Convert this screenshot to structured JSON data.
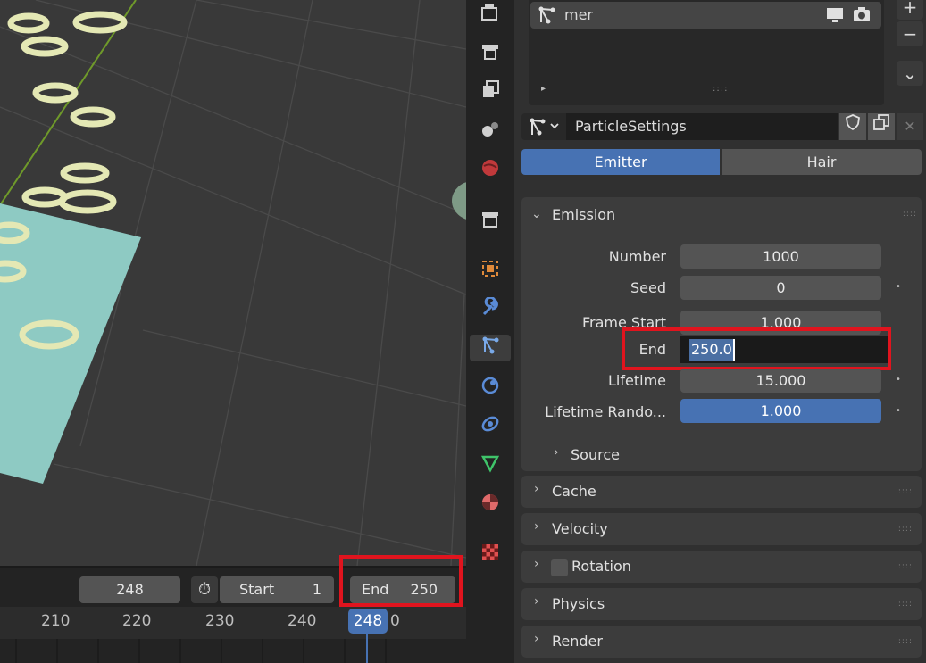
{
  "viewport": {},
  "timeline": {
    "current_frame": "248",
    "start_label": "Start",
    "start_value": "1",
    "end_label": "End",
    "end_value": "250",
    "ticks": [
      "210",
      "220",
      "230",
      "240",
      "0"
    ],
    "playhead": "248",
    "stopwatch_icon": "⏱"
  },
  "properties": {
    "particle_system_name": "mer",
    "settings_name": "ParticleSettings",
    "tabs": {
      "emitter": "Emitter",
      "hair": "Hair"
    },
    "emission": {
      "title": "Emission",
      "number_label": "Number",
      "number_value": "1000",
      "seed_label": "Seed",
      "seed_value": "0",
      "frame_start_label": "Frame Start",
      "frame_start_value": "1.000",
      "end_label": "End",
      "end_value": "250.0",
      "lifetime_label": "Lifetime",
      "lifetime_value": "15.000",
      "lifetime_random_label": "Lifetime Rando...",
      "lifetime_random_value": "1.000",
      "source_label": "Source"
    },
    "panels": {
      "cache": "Cache",
      "velocity": "Velocity",
      "rotation": "Rotation",
      "physics": "Physics",
      "render": "Render"
    },
    "icons": {
      "add": "+",
      "remove": "−",
      "menu": "⌄",
      "expand": "▸",
      "grip": "::::",
      "panel_grip": "::::",
      "dot": "•"
    }
  },
  "colors": {
    "accent": "#4772b3",
    "highlight": "#e0141e"
  }
}
